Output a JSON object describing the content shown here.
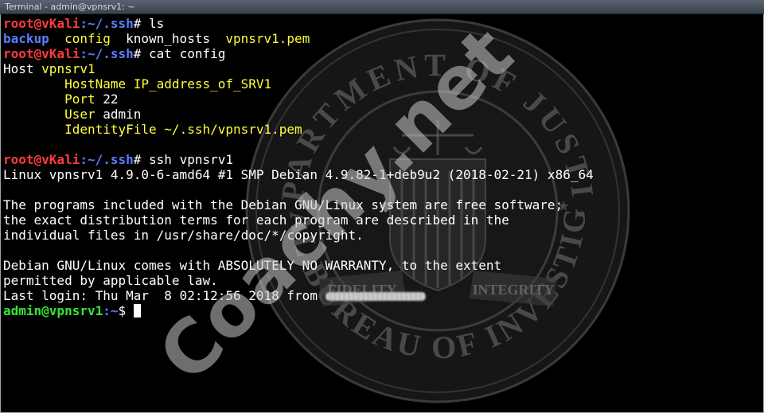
{
  "window": {
    "title": "Terminal - admin@vpnsrv1: ~"
  },
  "terminal": {
    "prompt_root": "root@vKali",
    "prompt_path_ssh": ":~/.ssh",
    "hash": "# ",
    "cmd_ls": "ls",
    "ls_backup": "backup",
    "ls_config": "config",
    "ls_known_hosts": "known_hosts",
    "ls_pem": "vpnsrv1.pem",
    "cmd_cat": "cat config",
    "cfg_host_key": "Host",
    "cfg_host_val": "vpnsrv1",
    "cfg_hostname_key": "HostName",
    "cfg_hostname_val": "IP_address_of_SRV1",
    "cfg_port_key": "Port",
    "cfg_port_val": "22",
    "cfg_user_key": "User",
    "cfg_user_val": "admin",
    "cfg_identity_key": "IdentityFile",
    "cfg_identity_val": "~/.ssh/vpnsrv1.pem",
    "cmd_ssh": "ssh vpnsrv1",
    "out_uname": "Linux vpnsrv1 4.9.0-6-amd64 #1 SMP Debian 4.9.82-1+deb9u2 (2018-02-21) x86_64",
    "out_motd_1": "The programs included with the Debian GNU/Linux system are free software;",
    "out_motd_2": "the exact distribution terms for each program are described in the",
    "out_motd_3": "individual files in /usr/share/doc/*/copyright.",
    "out_warranty_1": "Debian GNU/Linux comes with ABSOLUTELY NO WARRANTY, to the extent",
    "out_warranty_2": "permitted by applicable law.",
    "out_lastlogin": "Last login: Thu Mar  8 02:12:56 2018 from ",
    "prompt_admin": "admin@vpnsrv1",
    "prompt_admin_path": ":~",
    "prompt_admin_sign": "$ "
  },
  "watermark": {
    "text": "Coachy.net",
    "seal_top": "DEPARTMENT OF JUSTICE",
    "seal_bottom": "FEDERAL BUREAU OF INVESTIGATION",
    "seal_banner_left": "FIDELITY",
    "seal_banner_right": "INTEGRITY"
  },
  "colors": {
    "background": "#000000",
    "prompt_user": "#ff3b3b",
    "prompt_path": "#5c7cff",
    "config_key": "#ffff3b",
    "admin_prompt": "#36e636"
  }
}
